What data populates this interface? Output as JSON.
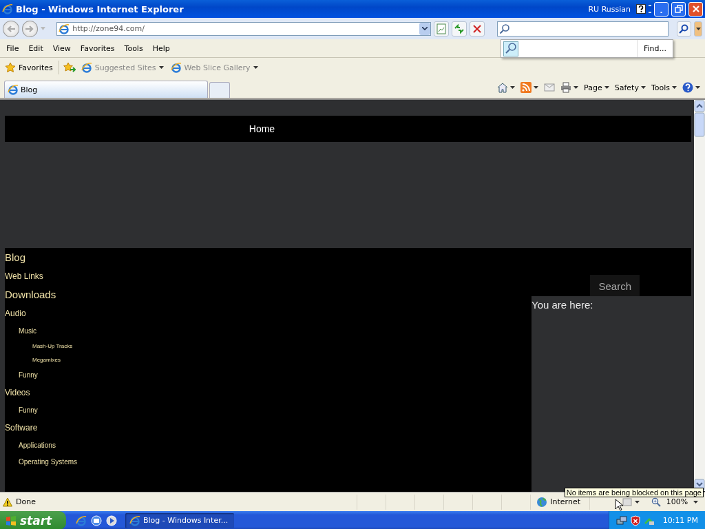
{
  "window": {
    "title": "Blog - Windows Internet Explorer",
    "language": "RU Russian"
  },
  "address_bar": {
    "url": "http://zone94.com/"
  },
  "find_popup": {
    "label": "Find..."
  },
  "menu": [
    "File",
    "Edit",
    "View",
    "Favorites",
    "Tools",
    "Help"
  ],
  "favorites_bar": {
    "favorites": "Favorites",
    "links": [
      "Suggested Sites",
      "Web Slice Gallery"
    ]
  },
  "tabs": [
    {
      "label": "Blog",
      "selected": true
    }
  ],
  "command_bar": [
    "Page",
    "Safety",
    "Tools"
  ],
  "page": {
    "nav": [
      "Home"
    ],
    "sidebar": [
      {
        "label": "Blog",
        "kind": "heading"
      },
      {
        "label": "Web Links",
        "kind": "item"
      },
      {
        "label": "Downloads",
        "kind": "heading"
      },
      {
        "label": "Audio",
        "kind": "item",
        "children": [
          {
            "label": "Music",
            "kind": "item",
            "children": [
              {
                "label": "Mash-Up Tracks",
                "kind": "item"
              },
              {
                "label": "Megamixes",
                "kind": "item"
              }
            ]
          },
          {
            "label": "Funny",
            "kind": "item"
          }
        ]
      },
      {
        "label": "Videos",
        "kind": "item",
        "children": [
          {
            "label": "Funny",
            "kind": "item"
          }
        ]
      },
      {
        "label": "Software",
        "kind": "item",
        "children": [
          {
            "label": "Applications",
            "kind": "item"
          },
          {
            "label": "Operating Systems",
            "kind": "item"
          }
        ]
      }
    ],
    "search_button": "Search",
    "breadcrumb_label": "You are here:"
  },
  "status_bar": {
    "text": "Done",
    "zone": "Internet",
    "zoom": "100%",
    "tooltip": "No items are being blocked on this page"
  },
  "taskbar": {
    "start": "start",
    "windows": [
      {
        "label": "Blog - Windows Inter...",
        "selected": true
      }
    ],
    "clock": "10:11 PM"
  }
}
